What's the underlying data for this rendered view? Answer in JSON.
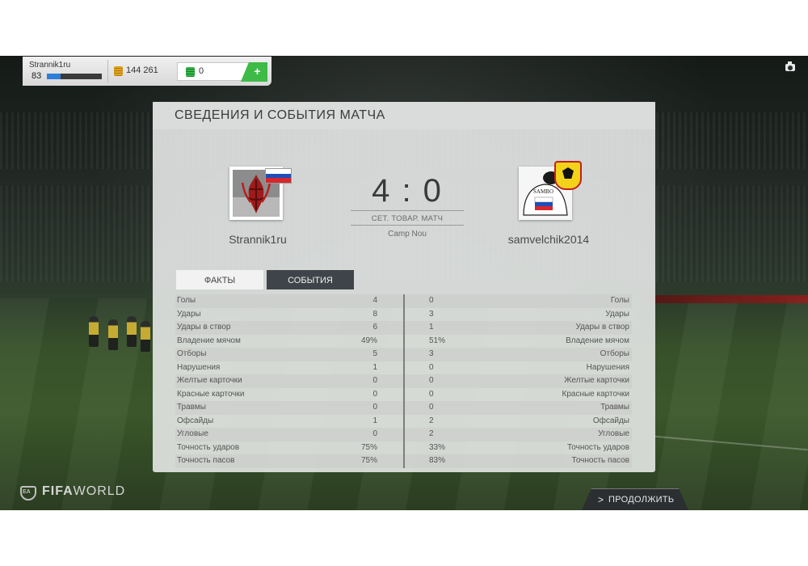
{
  "topbar": {
    "username": "Strannik1ru",
    "level": "83",
    "xp_fraction": 0.25,
    "coins": "144 261",
    "points": "0",
    "add_label": "+"
  },
  "panel": {
    "title": "СВЕДЕНИЯ И СОБЫТИЯ МАТЧА",
    "home_team": "Strannik1ru",
    "away_team": "samvelchik2014",
    "score": "4 : 0",
    "match_type": "СЕТ. ТОВАР. МАТЧ",
    "venue": "Camp Nou",
    "away_crest_text": "SAMBO",
    "tabs": {
      "facts": "ФАКТЫ",
      "events": "СОБЫТИЯ"
    }
  },
  "stats": [
    {
      "label": "Голы",
      "home": "4",
      "away": "0"
    },
    {
      "label": "Удары",
      "home": "8",
      "away": "3"
    },
    {
      "label": "Удары в створ",
      "home": "6",
      "away": "1"
    },
    {
      "label": "Владение мячом",
      "home": "49%",
      "away": "51%"
    },
    {
      "label": "Отборы",
      "home": "5",
      "away": "3"
    },
    {
      "label": "Нарушения",
      "home": "1",
      "away": "0"
    },
    {
      "label": "Желтые карточки",
      "home": "0",
      "away": "0"
    },
    {
      "label": "Красные карточки",
      "home": "0",
      "away": "0"
    },
    {
      "label": "Травмы",
      "home": "0",
      "away": "0"
    },
    {
      "label": "Офсайды",
      "home": "1",
      "away": "2"
    },
    {
      "label": "Угловые",
      "home": "0",
      "away": "2"
    },
    {
      "label": "Точность ударов",
      "home": "75%",
      "away": "33%"
    },
    {
      "label": "Точность пасов",
      "home": "75%",
      "away": "83%"
    }
  ],
  "branding": {
    "fifa": "FIFA",
    "world": "WORLD"
  },
  "footer": {
    "continue_arrow": ">",
    "continue_label": "ПРОДОЛЖИТЬ"
  },
  "colors": {
    "accent_green": "#3dbb46",
    "xp_blue": "#2f7fd8",
    "tab_dark": "#3e4449"
  }
}
